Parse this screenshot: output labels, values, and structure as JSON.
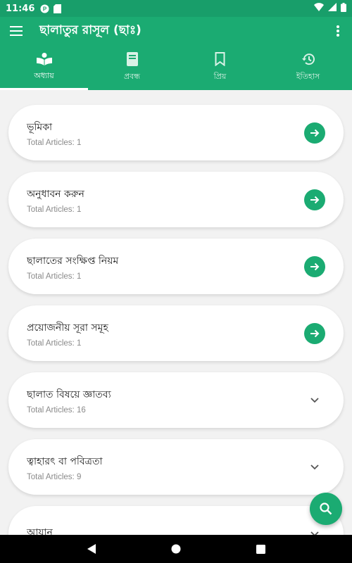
{
  "status_bar": {
    "time": "11:46",
    "icons": [
      "p-icon",
      "sd-card-icon",
      "wifi-icon",
      "signal-icon",
      "battery-icon"
    ]
  },
  "app_bar": {
    "title": "ছালাতুর রাসূল (ছাঃ)",
    "menu_icon": "hamburger-icon",
    "more_icon": "more-vert-icon"
  },
  "tabs": [
    {
      "label": "অধ্যায়",
      "icon": "reader-icon",
      "active": true
    },
    {
      "label": "প্রবন্ধ",
      "icon": "book-icon",
      "active": false
    },
    {
      "label": "প্রিয়",
      "icon": "bookmark-icon",
      "active": false
    },
    {
      "label": "ইতিহাস",
      "icon": "history-icon",
      "active": false
    }
  ],
  "chapters": [
    {
      "title": "ভূমিকা",
      "subtitle": "Total Articles: 1",
      "action": "arrow"
    },
    {
      "title": "অনুধাবন করুন",
      "subtitle": "Total Articles: 1",
      "action": "arrow"
    },
    {
      "title": "ছালাতের সংক্ষিপ্ত নিয়ম",
      "subtitle": "Total Articles: 1",
      "action": "arrow"
    },
    {
      "title": "প্রয়োজনীয় সূরা সমূহ",
      "subtitle": "Total Articles: 1",
      "action": "arrow"
    },
    {
      "title": "ছালাত বিষয়ে জ্ঞাতব্য",
      "subtitle": "Total Articles: 16",
      "action": "expand"
    },
    {
      "title": "ত্বাহারৎ বা পবিত্রতা",
      "subtitle": "Total Articles: 9",
      "action": "expand"
    },
    {
      "title": "আযান",
      "subtitle": "",
      "action": "expand"
    }
  ],
  "fab": {
    "icon": "search-icon"
  },
  "nav_bar": {
    "icons": [
      "back-icon",
      "home-icon",
      "recents-icon"
    ]
  },
  "colors": {
    "primary": "#1bab72",
    "status_bar": "#189e6a"
  }
}
